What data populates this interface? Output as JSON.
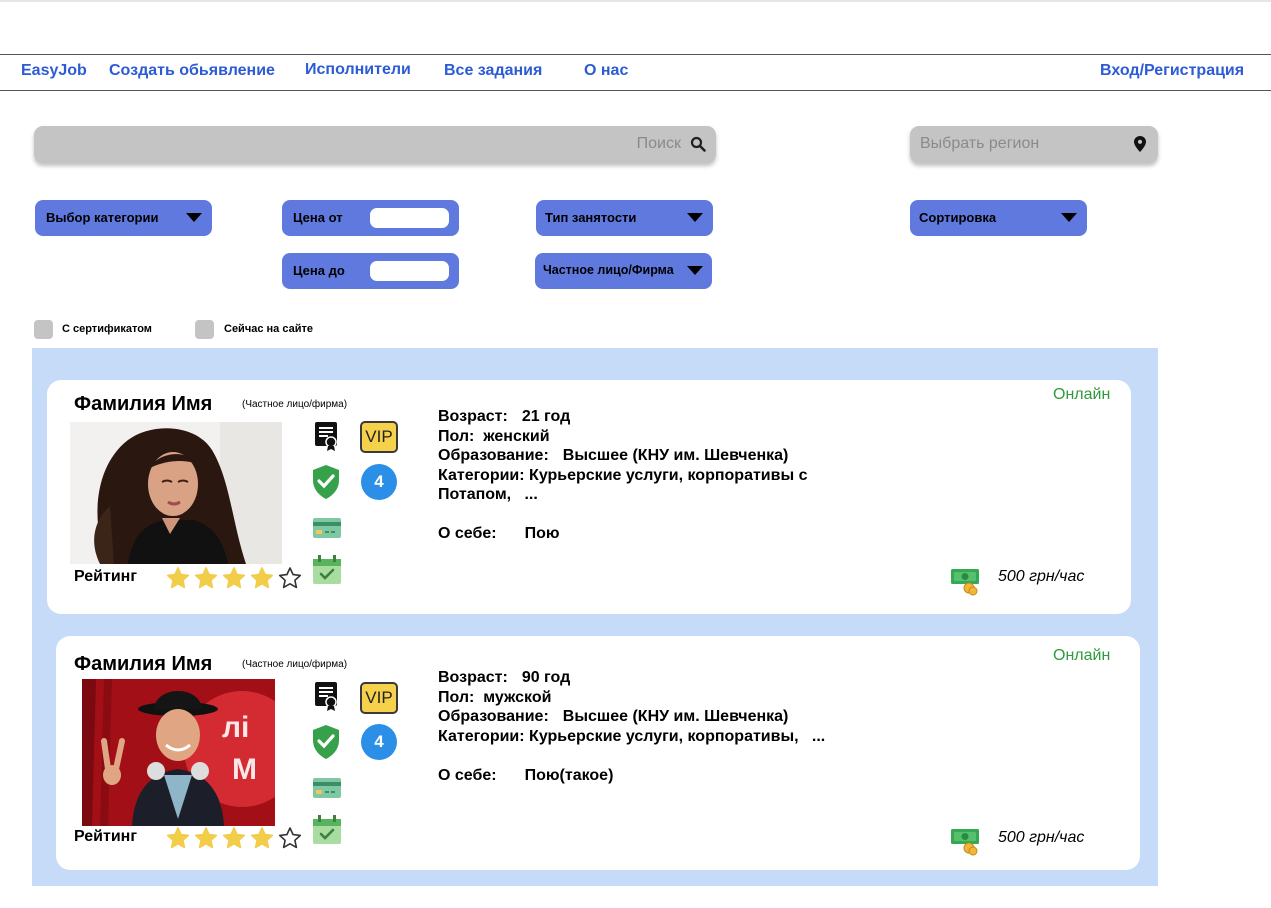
{
  "nav": {
    "brand": "EasyJob",
    "create_ad": "Создать обьявление",
    "performers": "Исполнители",
    "all_tasks": "Все задания",
    "about": "О нас",
    "login": "Вход/Регистрация"
  },
  "search": {
    "placeholder": "Поиск",
    "icon": "search-icon"
  },
  "region": {
    "placeholder": "Выбрать регион",
    "icon": "location-pin-icon"
  },
  "filters": {
    "category": "Выбор категории",
    "price_from": "Цена от",
    "price_to": "Цена до",
    "employment_type": "Тип занятости",
    "person_type": "Частное лицо/Фирма",
    "sort": "Сортировка"
  },
  "checkboxes": {
    "certificate": "С сертификатом",
    "online_now": "Сейчас на сайте"
  },
  "colors": {
    "accent": "#2d5bd6",
    "filter_bg": "#5f79de",
    "results_bg": "#c5dbf7",
    "online": "#2f9a3c",
    "star": "#f2cd4a"
  },
  "cards": [
    {
      "name": "Фамилия Имя",
      "type": "(Частное лицо/фирма)",
      "status": "Онлайн",
      "rating_label": "Рейтинг",
      "rating": 4,
      "rating_max": 5,
      "vip": "VIP",
      "level": "4",
      "age_label": "Возраст:",
      "age": "21 год",
      "gender_label": "Пол:",
      "gender": "женский",
      "education_label": "Образование:",
      "education": "Высшее (КНУ им. Шевченка)",
      "categories_label": "Категории:",
      "categories_line1": "Курьерские услуги, корпоративы с",
      "categories_line2": "Потапом,   ...",
      "about_label": "О себе:",
      "about": "Пою",
      "price": "500 грн/час"
    },
    {
      "name": "Фамилия Имя",
      "type": "(Частное лицо/фирма)",
      "status": "Онлайн",
      "rating_label": "Рейтинг",
      "rating": 4,
      "rating_max": 5,
      "vip": "VIP",
      "level": "4",
      "age_label": "Возраст:",
      "age": "90 год",
      "gender_label": "Пол:",
      "gender": "мужской",
      "education_label": "Образование:",
      "education": "Высшее (КНУ им. Шевченка)",
      "categories_label": "Категории:",
      "categories_line1": "Курьерские услуги, корпоративы,   ...",
      "categories_line2": "",
      "about_label": "О себе:",
      "about": "Пою(такое)",
      "price": "500 грн/час"
    }
  ]
}
